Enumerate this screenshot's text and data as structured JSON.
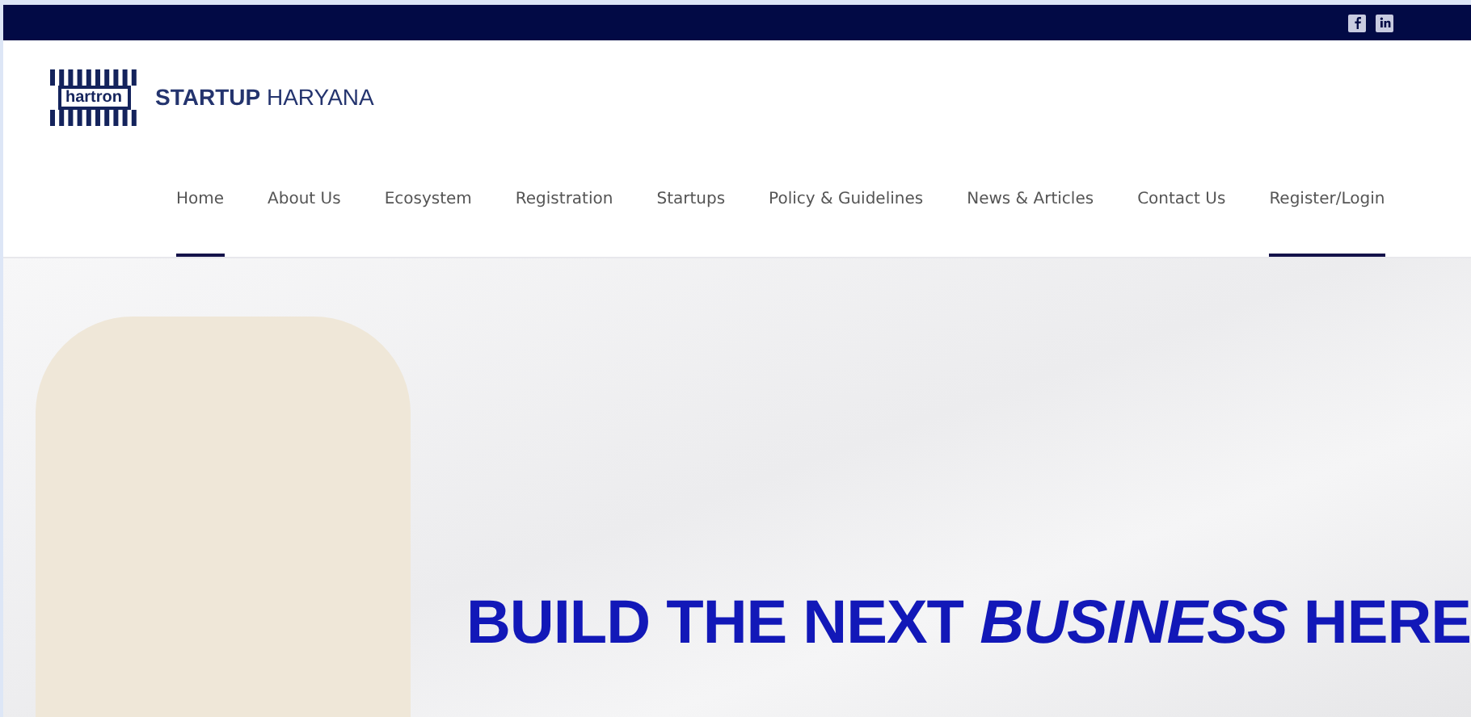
{
  "top_bar": {
    "social": [
      {
        "kind": "facebook"
      },
      {
        "kind": "linkedin"
      }
    ]
  },
  "logo": {
    "mark_text": "hartron",
    "brand": "**STARTUP** HARYANA"
  },
  "nav": [
    {
      "label": "Home",
      "selected": true
    },
    {
      "label": "About Us",
      "selected": false
    },
    {
      "label": "Ecosystem",
      "selected": false
    },
    {
      "label": "Registration",
      "selected": false
    },
    {
      "label": "Startups",
      "selected": false
    },
    {
      "label": "Policy & Guidelines",
      "selected": false
    },
    {
      "label": "News & Articles",
      "selected": false
    },
    {
      "label": "Contact Us",
      "selected": false
    },
    {
      "label": "Register/Login",
      "selected": true
    }
  ],
  "hero": {
    "headline": "BUILD THE NEXT *BUSINESS* HERE"
  }
}
